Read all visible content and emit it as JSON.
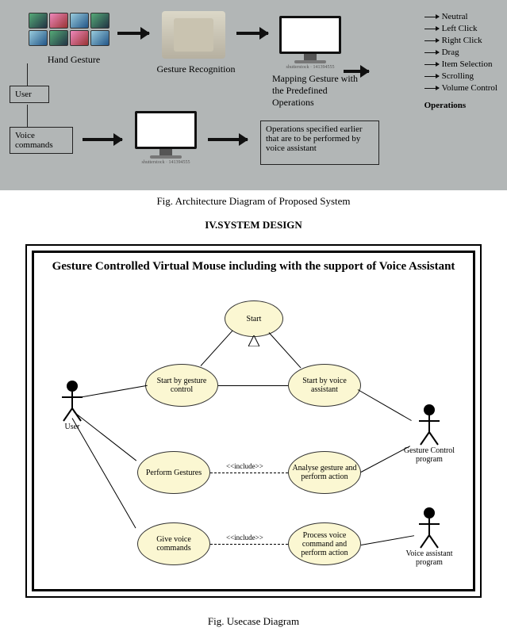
{
  "arch": {
    "hand_gesture": "Hand Gesture",
    "gesture_recognition": "Gesture Recognition",
    "mapping": "Mapping Gesture with the Predefined Operations",
    "user": "User",
    "voice_commands": "Voice commands",
    "voice_ops_box": "Operations specified earlier that are to be performed by voice assistant",
    "operations_header": "Operations",
    "operations": [
      "Neutral",
      "Left Click",
      "Right Click",
      "Drag",
      "Item Selection",
      "Scrolling",
      "Volume Control"
    ],
    "caption": "Fig. Architecture Diagram of Proposed System"
  },
  "section4": "IV.SYSTEM  DESIGN",
  "usecase": {
    "title": "Gesture Controlled Virtual Mouse including with the support of Voice Assistant",
    "start": "Start",
    "start_gesture": "Start by gesture control",
    "start_voice": "Start by voice assistant",
    "perform_gestures": "Perform Gestures",
    "analyse": "Analyse gesture and perform action",
    "give_voice": "Give voice commands",
    "process_voice": "Process voice command and perform action",
    "include": "<<include>>",
    "actors": {
      "user": "User",
      "gc": "Gesture Control program",
      "va": "Voice assistant program"
    },
    "caption": "Fig. Usecase Diagram"
  },
  "chart_data": {
    "type": "diagram",
    "architecture": {
      "nodes": [
        {
          "id": "user",
          "label": "User"
        },
        {
          "id": "hand_gesture",
          "label": "Hand Gesture"
        },
        {
          "id": "voice_commands",
          "label": "Voice commands"
        },
        {
          "id": "gesture_recognition",
          "label": "Gesture Recognition"
        },
        {
          "id": "mapping",
          "label": "Mapping Gesture with the Predefined Operations"
        },
        {
          "id": "voice_system",
          "label": "(computer / voice assistant)"
        },
        {
          "id": "voice_ops",
          "label": "Operations specified earlier that are to be performed by voice assistant"
        },
        {
          "id": "operations",
          "label": "Operations",
          "items": [
            "Neutral",
            "Left Click",
            "Right Click",
            "Drag",
            "Item Selection",
            "Scrolling",
            "Volume Control"
          ]
        }
      ],
      "edges": [
        {
          "from": "user",
          "to": "hand_gesture"
        },
        {
          "from": "user",
          "to": "voice_commands"
        },
        {
          "from": "hand_gesture",
          "to": "gesture_recognition"
        },
        {
          "from": "gesture_recognition",
          "to": "mapping"
        },
        {
          "from": "mapping",
          "to": "operations"
        },
        {
          "from": "voice_commands",
          "to": "voice_system"
        },
        {
          "from": "voice_system",
          "to": "voice_ops"
        }
      ]
    },
    "usecase": {
      "actors": [
        "User",
        "Gesture Control program",
        "Voice assistant program"
      ],
      "usecases": [
        "Start",
        "Start by gesture control",
        "Start by voice assistant",
        "Perform Gestures",
        "Analyse gesture and perform action",
        "Give voice commands",
        "Process voice command and perform action"
      ],
      "associations": [
        {
          "actor": "User",
          "usecase": "Start by gesture control"
        },
        {
          "actor": "User",
          "usecase": "Perform Gestures"
        },
        {
          "actor": "User",
          "usecase": "Give voice commands"
        },
        {
          "actor": "Gesture Control program",
          "usecase": "Start by voice assistant"
        },
        {
          "actor": "Gesture Control program",
          "usecase": "Analyse gesture and perform action"
        },
        {
          "actor": "Voice assistant program",
          "usecase": "Process voice command and perform action"
        }
      ],
      "generalizations": [
        {
          "child": "Start by gesture control",
          "parent": "Start"
        },
        {
          "child": "Start by voice assistant",
          "parent": "Start"
        }
      ],
      "includes": [
        {
          "from": "Perform Gestures",
          "to": "Analyse gesture and perform action"
        },
        {
          "from": "Give voice commands",
          "to": "Process voice command and perform action"
        }
      ]
    }
  }
}
